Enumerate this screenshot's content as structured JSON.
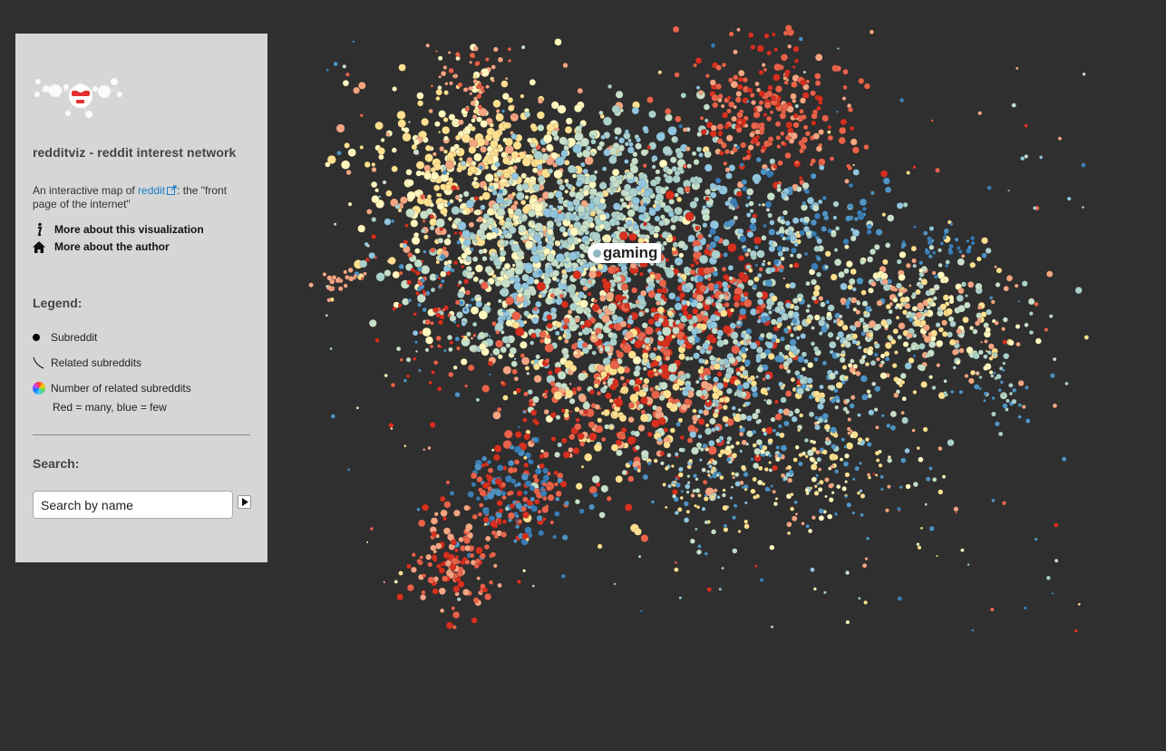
{
  "app": {
    "title": "redditviz - reddit interest network"
  },
  "intro": {
    "prefix": "An interactive map of ",
    "link_text": "reddit",
    "suffix": ": the \"front page of the internet\""
  },
  "links": {
    "about_viz": "More about this visualization",
    "about_author": "More about the author"
  },
  "legend": {
    "heading": "Legend:",
    "subreddit": "Subreddit",
    "related": "Related subreddits",
    "count": "Number of related subreddits",
    "note": "Red = many, blue = few"
  },
  "search": {
    "heading": "Search:",
    "placeholder": "Search by name"
  },
  "graph": {
    "highlight_label": "gaming",
    "palette": [
      "#d7301f",
      "#e8634a",
      "#f4a582",
      "#fee090",
      "#fff7bf",
      "#c7dfc9",
      "#abd0cc",
      "#92c5de",
      "#4f94c4",
      "#3a7db5"
    ]
  }
}
